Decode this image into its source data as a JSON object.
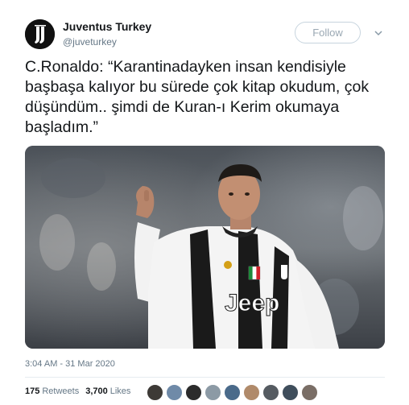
{
  "account": {
    "display_name": "Juventus Turkey",
    "handle": "@juveturkey",
    "follow_label": "Follow"
  },
  "tweet": {
    "text": "C.Ronaldo: “Karantinadayken insan kendisiyle başbaşa kalıyor bu sürede çok kitap okudum, çok düşündüm.. şimdi de Kuran-ı Kerim okumaya başladım.”",
    "timestamp": "3:04 AM - 31 Mar 2020"
  },
  "media": {
    "jersey_text": "Jeep"
  },
  "stats": {
    "retweets_count": "175",
    "retweets_label": "Retweets",
    "likes_count": "3,700",
    "likes_label": "Likes"
  },
  "likers": [
    {
      "color": "#3d3a36"
    },
    {
      "color": "#6f8aa8"
    },
    {
      "color": "#2b2b2b"
    },
    {
      "color": "#8c9aa5"
    },
    {
      "color": "#4a6a8a"
    },
    {
      "color": "#b08a6a"
    },
    {
      "color": "#555b61"
    },
    {
      "color": "#3f4e5c"
    },
    {
      "color": "#7a6e66"
    }
  ],
  "colors": {
    "text": "#14171a",
    "muted": "#657786",
    "follow_border": "#c7d4de"
  }
}
